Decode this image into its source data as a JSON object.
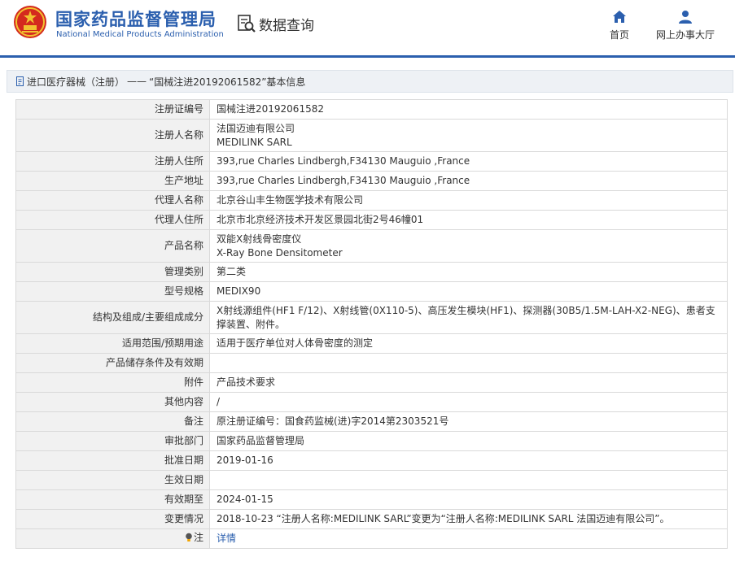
{
  "header": {
    "site_name": "国家药品监督管理局",
    "site_name_en": "National Medical Products Administration",
    "query_label": "数据查询",
    "nav": {
      "home": "首页",
      "service_hall": "网上办事大厅"
    }
  },
  "breadcrumb": {
    "category": "进口医疗器械（注册）",
    "separator": "——",
    "record": "“国械注进20192061582”基本信息"
  },
  "rows": [
    {
      "label": "注册证编号",
      "lines": [
        "国械注进20192061582"
      ]
    },
    {
      "label": "注册人名称",
      "lines": [
        "法国迈迪有限公司",
        "MEDILINK SARL"
      ]
    },
    {
      "label": "注册人住所",
      "lines": [
        "393,rue Charles Lindbergh,F34130 Mauguio ,France"
      ]
    },
    {
      "label": "生产地址",
      "lines": [
        "393,rue Charles Lindbergh,F34130 Mauguio ,France"
      ]
    },
    {
      "label": "代理人名称",
      "lines": [
        "北京谷山丰生物医学技术有限公司"
      ]
    },
    {
      "label": "代理人住所",
      "lines": [
        "北京市北京经济技术开发区景园北街2号46幢01"
      ]
    },
    {
      "label": "产品名称",
      "lines": [
        "双能X射线骨密度仪",
        "X-Ray Bone Densitometer"
      ]
    },
    {
      "label": "管理类别",
      "lines": [
        "第二类"
      ]
    },
    {
      "label": "型号规格",
      "lines": [
        "MEDIX90"
      ]
    },
    {
      "label": "结构及组成/主要组成成分",
      "lines": [
        "X射线源组件(HF1 F/12)、X射线管(0X110-5)、高压发生模块(HF1)、探测器(30B5/1.5M-LAH-X2-NEG)、患者支撑装置、附件。"
      ]
    },
    {
      "label": "适用范围/预期用途",
      "lines": [
        "适用于医疗单位对人体骨密度的测定"
      ]
    },
    {
      "label": "产品储存条件及有效期",
      "lines": [
        ""
      ]
    },
    {
      "label": "附件",
      "lines": [
        "产品技术要求"
      ]
    },
    {
      "label": "其他内容",
      "lines": [
        "/"
      ]
    },
    {
      "label": "备注",
      "lines": [
        "原注册证编号：国食药监械(进)字2014第2303521号"
      ]
    },
    {
      "label": "审批部门",
      "lines": [
        "国家药品监督管理局"
      ]
    },
    {
      "label": "批准日期",
      "lines": [
        "2019-01-16"
      ]
    },
    {
      "label": "生效日期",
      "lines": [
        ""
      ]
    },
    {
      "label": "有效期至",
      "lines": [
        "2024-01-15"
      ]
    },
    {
      "label": "变更情况",
      "lines": [
        "2018-10-23 “注册人名称:MEDILINK SARL”变更为“注册人名称:MEDILINK SARL 法国迈迪有限公司”。"
      ]
    }
  ],
  "note_row": {
    "label": "注",
    "link_text": "详情",
    "icon": "lightbulb-icon"
  },
  "colors": {
    "brand_blue": "#2b5fae",
    "emblem_red": "#d42a1e",
    "emblem_gold": "#f2c230",
    "label_bg": "#f1f1f1",
    "border": "#d9d9d9"
  }
}
